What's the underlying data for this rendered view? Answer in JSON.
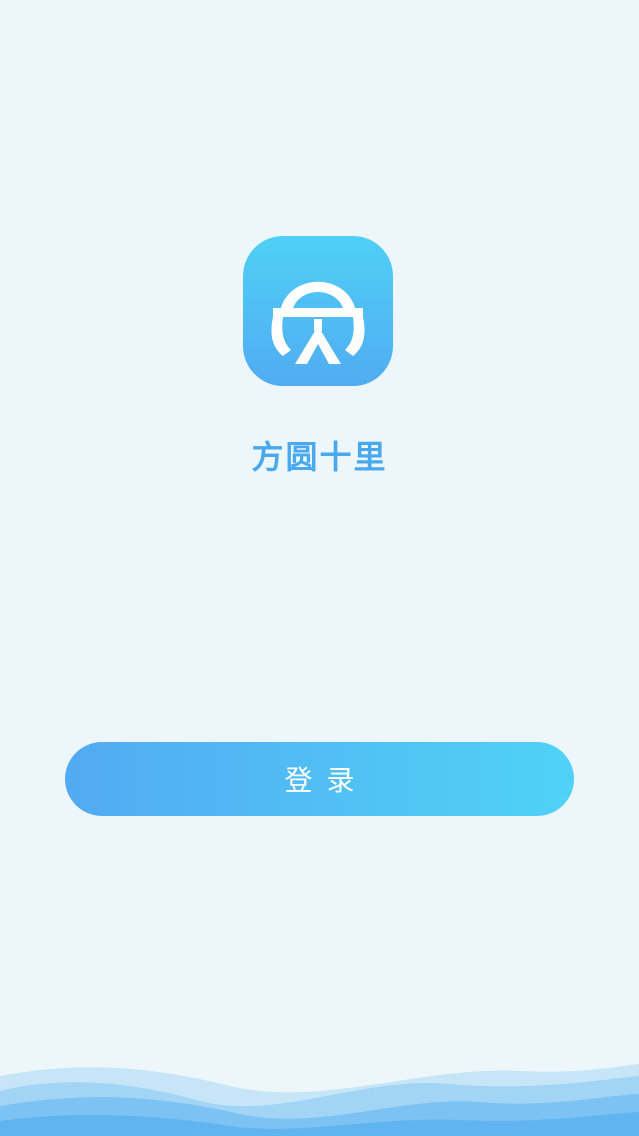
{
  "app": {
    "name": "方圆十里"
  },
  "login_button": {
    "label": "登录"
  },
  "colors": {
    "background": "#edf6fa",
    "accent": "#4aa8ee",
    "gradient_start": "#52aaf2",
    "gradient_end": "#50d2f6"
  },
  "icons": {
    "logo": "app-logo-icon",
    "decoration": "wave-decoration"
  }
}
